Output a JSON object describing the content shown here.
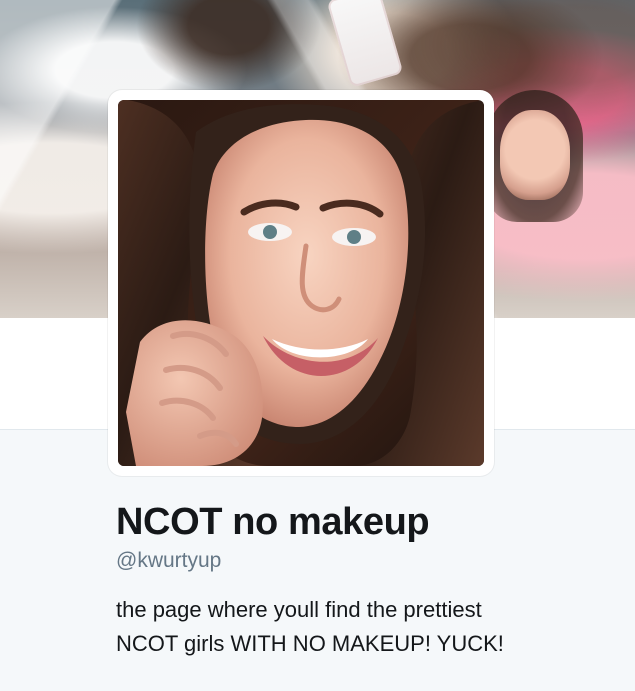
{
  "profile": {
    "display_name": "NCOT no makeup",
    "screen_name": "@kwurtyup",
    "bio": "the page where youll find the prettiest\nNCOT girls WITH NO MAKEUP! YUCK!",
    "header_image": "header-photo",
    "avatar_image": "profile-photo"
  },
  "colors": {
    "page_background": "#f5f8fa",
    "white_band": "#ffffff",
    "text_primary": "#14171a",
    "text_secondary": "#657786"
  }
}
